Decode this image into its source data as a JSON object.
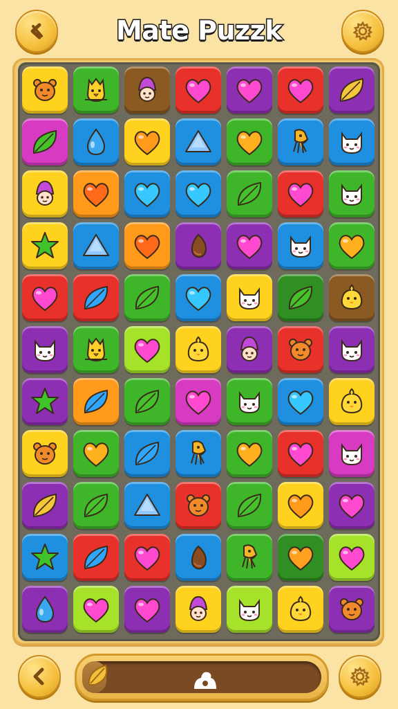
{
  "header": {
    "title": "Mate Puzzk",
    "back_icon": "chevron-left-icon",
    "settings_icon": "gear-icon"
  },
  "footer": {
    "back_icon": "chevron-left-icon",
    "settings_icon": "gear-icon",
    "progress": 0.1,
    "progress_leaf_icon": "leaf-icon",
    "progress_knob_icon": "knob-icon"
  },
  "colors": {
    "y": "#ffd21f",
    "g": "#3fb52a",
    "b": "#8a5a22",
    "r": "#e8312a",
    "p": "#8d2fb3",
    "o": "#ff9a1a",
    "m": "#d63bc2",
    "u": "#1f8fe0",
    "l": "#a6e22a",
    "d": "#2f8f22"
  },
  "board": {
    "rows": [
      [
        [
          "y",
          "bear"
        ],
        [
          "g",
          "bird"
        ],
        [
          "b",
          "gnome"
        ],
        [
          "r",
          "heart"
        ],
        [
          "p",
          "heart"
        ],
        [
          "r",
          "heart"
        ],
        [
          "p",
          "leaf"
        ]
      ],
      [
        [
          "m",
          "leaf"
        ],
        [
          "u",
          "drop"
        ],
        [
          "y",
          "heart"
        ],
        [
          "u",
          "triangle"
        ],
        [
          "g",
          "heart"
        ],
        [
          "u",
          "squid"
        ],
        [
          "u",
          "cat"
        ]
      ],
      [
        [
          "y",
          "gnome"
        ],
        [
          "o",
          "heart"
        ],
        [
          "u",
          "heart"
        ],
        [
          "u",
          "heart"
        ],
        [
          "g",
          "leaf"
        ],
        [
          "r",
          "heart"
        ],
        [
          "g",
          "cat"
        ]
      ],
      [
        [
          "y",
          "star"
        ],
        [
          "u",
          "triangle"
        ],
        [
          "o",
          "heart"
        ],
        [
          "p",
          "seed"
        ],
        [
          "p",
          "heart"
        ],
        [
          "u",
          "cat"
        ],
        [
          "g",
          "heart"
        ]
      ],
      [
        [
          "r",
          "heart"
        ],
        [
          "r",
          "leaf"
        ],
        [
          "g",
          "leaf"
        ],
        [
          "u",
          "heart"
        ],
        [
          "y",
          "cat"
        ],
        [
          "d",
          "leaf"
        ],
        [
          "b",
          "chick"
        ]
      ],
      [
        [
          "p",
          "cat"
        ],
        [
          "g",
          "bird"
        ],
        [
          "l",
          "heart"
        ],
        [
          "y",
          "chick"
        ],
        [
          "p",
          "gnome"
        ],
        [
          "r",
          "bear"
        ],
        [
          "p",
          "cat"
        ]
      ],
      [
        [
          "p",
          "star"
        ],
        [
          "o",
          "leaf"
        ],
        [
          "g",
          "leaf"
        ],
        [
          "m",
          "heart"
        ],
        [
          "g",
          "cat"
        ],
        [
          "u",
          "heart"
        ],
        [
          "y",
          "chick"
        ]
      ],
      [
        [
          "y",
          "bear"
        ],
        [
          "g",
          "heart"
        ],
        [
          "u",
          "leaf"
        ],
        [
          "u",
          "squid"
        ],
        [
          "g",
          "heart"
        ],
        [
          "r",
          "heart"
        ],
        [
          "m",
          "cat"
        ]
      ],
      [
        [
          "p",
          "leaf"
        ],
        [
          "g",
          "leaf"
        ],
        [
          "u",
          "triangle"
        ],
        [
          "r",
          "bear"
        ],
        [
          "g",
          "leaf"
        ],
        [
          "y",
          "heart"
        ],
        [
          "p",
          "heart"
        ]
      ],
      [
        [
          "u",
          "star"
        ],
        [
          "r",
          "leaf"
        ],
        [
          "r",
          "heart"
        ],
        [
          "u",
          "seed"
        ],
        [
          "g",
          "squid"
        ],
        [
          "d",
          "heart"
        ],
        [
          "l",
          "heart"
        ]
      ],
      [
        [
          "p",
          "drop"
        ],
        [
          "l",
          "heart"
        ],
        [
          "p",
          "heart"
        ],
        [
          "y",
          "gnome"
        ],
        [
          "l",
          "cat"
        ],
        [
          "y",
          "chick"
        ],
        [
          "p",
          "bear"
        ]
      ]
    ]
  }
}
